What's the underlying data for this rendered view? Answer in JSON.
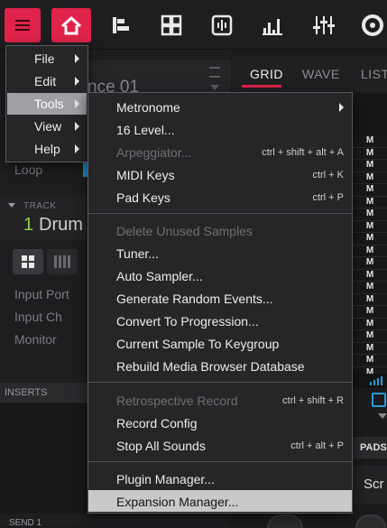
{
  "main_menu": {
    "items": [
      {
        "label": "File"
      },
      {
        "label": "Edit"
      },
      {
        "label": "Tools"
      },
      {
        "label": "View"
      },
      {
        "label": "Help"
      }
    ],
    "highlighted": "Tools"
  },
  "tools_menu": {
    "items": [
      {
        "label": "Metronome",
        "shortcut": "",
        "submenu": true,
        "disabled": false
      },
      {
        "label": "16 Level...",
        "shortcut": "",
        "disabled": false
      },
      {
        "label": "Arpeggiator...",
        "shortcut": "ctrl + shift + alt + A",
        "disabled": true
      },
      {
        "label": "MIDI Keys",
        "shortcut": "ctrl + K",
        "disabled": false
      },
      {
        "label": "Pad Keys",
        "shortcut": "ctrl + P",
        "disabled": false
      },
      {
        "label": "Delete Unused Samples",
        "shortcut": "",
        "disabled": true
      },
      {
        "label": "Tuner...",
        "shortcut": "",
        "disabled": false
      },
      {
        "label": "Auto Sampler...",
        "shortcut": "",
        "disabled": false
      },
      {
        "label": "Generate Random Events...",
        "shortcut": "",
        "disabled": false
      },
      {
        "label": "Convert To Progression...",
        "shortcut": "",
        "disabled": false
      },
      {
        "label": "Current Sample To Keygroup",
        "shortcut": "",
        "disabled": false
      },
      {
        "label": "Rebuild Media Browser Database",
        "shortcut": "",
        "disabled": false
      },
      {
        "label": "Retrospective Record",
        "shortcut": "ctrl + shift + R",
        "disabled": true
      },
      {
        "label": "Record Config",
        "shortcut": "",
        "disabled": false
      },
      {
        "label": "Stop All Sounds",
        "shortcut": "ctrl + alt + P",
        "disabled": false
      },
      {
        "label": "Plugin Manager...",
        "shortcut": "",
        "disabled": false
      },
      {
        "label": "Expansion Manager...",
        "shortcut": "",
        "disabled": false
      }
    ],
    "highlighted": "Expansion Manager..."
  },
  "background": {
    "sequence_name_partial": "nce 01",
    "loop_label": "Loop",
    "track_small_label": "TRACK",
    "track_number": "1",
    "track_name": "Drum",
    "input_port_label": "Input Port",
    "input_ch_label": "Input Ch",
    "monitor_label": "Monitor",
    "inserts_label": "INSERTS",
    "send_label": "SEND 1",
    "tabs": [
      "GRID",
      "WAVE",
      "LIST"
    ],
    "active_tab": "GRID",
    "mute_letter": "M",
    "pads_label": "PADS",
    "scr_label": "Scr"
  },
  "colors": {
    "accent": "#e0234a",
    "track_number": "#8ed24a",
    "menu_bg": "#262628",
    "highlight": "#c9c9cc"
  }
}
